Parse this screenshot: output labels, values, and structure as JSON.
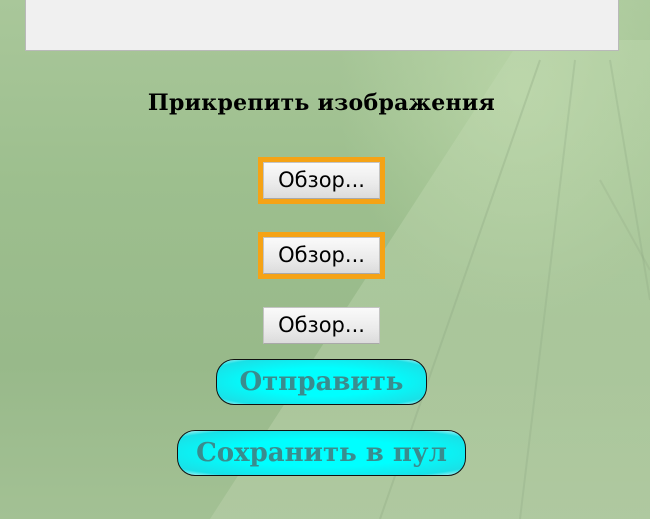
{
  "message_box": {
    "value": ""
  },
  "attachments": {
    "heading": "Прикрепить изображения",
    "browse_buttons": [
      {
        "label": "Обзор...",
        "focused": true
      },
      {
        "label": "Обзор...",
        "focused": true
      },
      {
        "label": "Обзор...",
        "focused": false
      }
    ]
  },
  "actions": {
    "submit_label": "Отправить",
    "save_to_pool_label": "Сохранить в пул"
  },
  "colors": {
    "focus_outline": "#f5a316",
    "action_button_fill": "#00ffff",
    "action_button_text": "#3a8c8e",
    "page_background": "#a2c394"
  }
}
